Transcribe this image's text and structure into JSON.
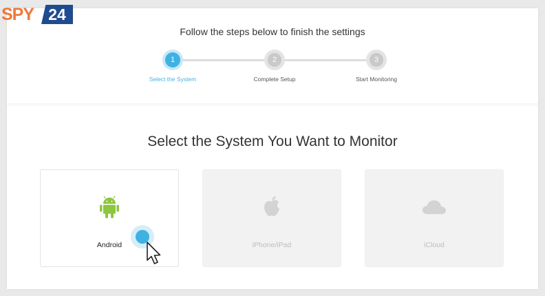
{
  "brand": {
    "left": "SPY",
    "right": "24",
    "left_color": "#f0793a",
    "right_color": "#1f4c8f"
  },
  "header": {
    "title": "Follow the steps below to finish the settings"
  },
  "stepper": {
    "accent_color": "#3fb2e3",
    "steps": [
      {
        "number": "1",
        "label": "Select the System",
        "state": "active"
      },
      {
        "number": "2",
        "label": "Complete Setup",
        "state": "inactive"
      },
      {
        "number": "3",
        "label": "Start Monitoring",
        "state": "inactive"
      }
    ]
  },
  "main": {
    "title": "Select the System You Want to Monitor",
    "options": [
      {
        "label": "Android",
        "icon": "android-icon",
        "icon_color": "#8dc63f",
        "enabled": true
      },
      {
        "label": "iPhone/iPad",
        "icon": "apple-icon",
        "icon_color": "#d3d3d3",
        "enabled": false
      },
      {
        "label": "iCloud",
        "icon": "cloud-icon",
        "icon_color": "#d3d3d3",
        "enabled": false
      }
    ]
  },
  "cursor": {
    "icon": "mouse-pointer-icon"
  }
}
